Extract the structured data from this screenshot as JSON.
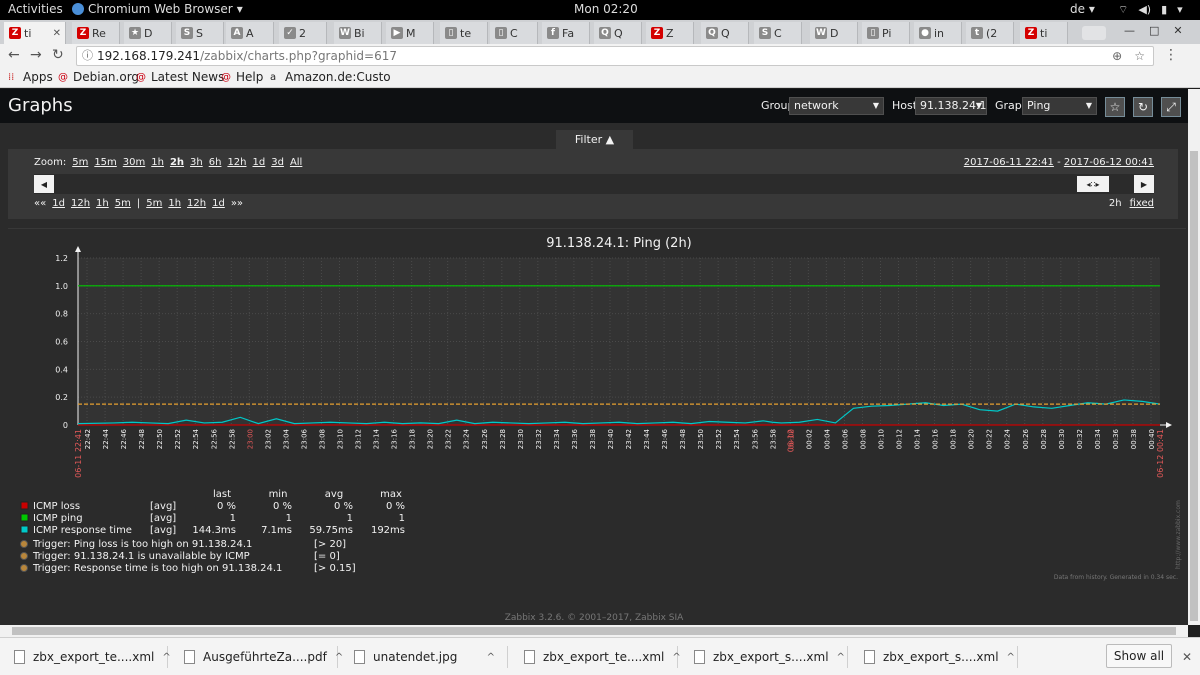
{
  "topbar": {
    "activities": "Activities",
    "app": "Chromium Web Browser",
    "clock": "Mon 02:20",
    "lang": "de"
  },
  "tabs": [
    {
      "label": "ti",
      "fav": "Z"
    },
    {
      "label": "Re",
      "fav": "Z"
    },
    {
      "label": "D",
      "fav": "★"
    },
    {
      "label": "S",
      "fav": "S"
    },
    {
      "label": "A",
      "fav": "A"
    },
    {
      "label": "2",
      "fav": "✓"
    },
    {
      "label": "Bi",
      "fav": "W"
    },
    {
      "label": "M",
      "fav": "▶"
    },
    {
      "label": "te",
      "fav": "▯"
    },
    {
      "label": "C",
      "fav": "▯"
    },
    {
      "label": "Fa",
      "fav": "f"
    },
    {
      "label": "Q",
      "fav": "Q"
    },
    {
      "label": "Z",
      "fav": "Z"
    },
    {
      "label": "Q",
      "fav": "Q"
    },
    {
      "label": "C",
      "fav": "S"
    },
    {
      "label": "D",
      "fav": "W"
    },
    {
      "label": "Pi",
      "fav": "▯"
    },
    {
      "label": "in",
      "fav": "●"
    },
    {
      "label": "(2",
      "fav": "t"
    },
    {
      "label": "ti",
      "fav": "Z"
    }
  ],
  "toolbar": {
    "url_host": "192.168.179.241",
    "url_path": "/zabbix/charts.php?graphid=617"
  },
  "bookmarks": [
    {
      "label": "Apps"
    },
    {
      "label": "Debian.org"
    },
    {
      "label": "Latest News"
    },
    {
      "label": "Help"
    },
    {
      "label": "Amazon.de:Custo"
    }
  ],
  "page": {
    "title": "Graphs",
    "group_label": "Group",
    "group_value": "network",
    "host_label": "Host",
    "host_value": "91.138.24.1",
    "graph_label": "Graph",
    "graph_value": "Ping",
    "filter_label": "Filter ▲"
  },
  "filter": {
    "zoom_label": "Zoom:",
    "zoom_options": [
      "5m",
      "15m",
      "30m",
      "1h",
      "2h",
      "3h",
      "6h",
      "12h",
      "1d",
      "3d",
      "All"
    ],
    "zoom_selected": "2h",
    "period_from": "2017-06-11 22:41",
    "period_sep": " - ",
    "period_to": "2017-06-12 00:41",
    "nav_back": [
      "««",
      "1d",
      "12h",
      "1h",
      "5m"
    ],
    "nav_sep": "|",
    "nav_fwd": [
      "5m",
      "1h",
      "12h",
      "1d",
      "»»"
    ],
    "duration": "2h",
    "fixed": "fixed"
  },
  "chart_data": {
    "type": "line",
    "title": "91.138.24.1: Ping (2h)",
    "ylim": [
      0,
      1.2
    ],
    "y_ticks": [
      "1.2",
      "1.0",
      "0.8",
      "0.6",
      "0.4",
      "0.2",
      "0"
    ],
    "x_ticks": [
      "22:42",
      "22:44",
      "22:46",
      "22:48",
      "22:50",
      "22:52",
      "22:54",
      "22:56",
      "22:58",
      "23:00",
      "23:02",
      "23:04",
      "23:06",
      "23:08",
      "23:10",
      "23:12",
      "23:14",
      "23:16",
      "23:18",
      "23:20",
      "23:22",
      "23:24",
      "23:26",
      "23:28",
      "23:30",
      "23:32",
      "23:34",
      "23:36",
      "23:38",
      "23:40",
      "23:42",
      "23:44",
      "23:46",
      "23:48",
      "23:50",
      "23:52",
      "23:54",
      "23:56",
      "23:58",
      "00:00",
      "00:02",
      "00:04",
      "00:06",
      "00:08",
      "00:10",
      "00:12",
      "00:14",
      "00:16",
      "00:18",
      "00:20",
      "00:22",
      "00:24",
      "00:26",
      "00:28",
      "00:30",
      "00:32",
      "00:34",
      "00:36",
      "00:38",
      "00:40"
    ],
    "x_red_ticks": [
      "23:00",
      "00:00"
    ],
    "x_start_label": "06-11 22:41",
    "x_end_label": "06-12 00:41",
    "x_mid_label": "06-12",
    "x_range_min": [
      0,
      120
    ],
    "series": [
      {
        "name": "ICMP loss",
        "color": "#c80000",
        "x": [
          0,
          120
        ],
        "y": [
          0,
          0
        ]
      },
      {
        "name": "ICMP ping",
        "color": "#00c800",
        "x": [
          0,
          120
        ],
        "y": [
          1,
          1
        ]
      },
      {
        "name": "ICMP response time",
        "color": "#00c8c8",
        "x": [
          0,
          4,
          6,
          8,
          10,
          12,
          14,
          16,
          18,
          20,
          22,
          24,
          26,
          28,
          30,
          32,
          34,
          36,
          38,
          40,
          42,
          44,
          46,
          48,
          50,
          52,
          54,
          56,
          58,
          60,
          62,
          64,
          66,
          68,
          70,
          72,
          74,
          76,
          77,
          78,
          80,
          82,
          84,
          86,
          88,
          90,
          92,
          94,
          96,
          98,
          100,
          102,
          104,
          106,
          108,
          110,
          112,
          114,
          116,
          118,
          120
        ],
        "y": [
          0.01,
          0.015,
          0.02,
          0.015,
          0.01,
          0.035,
          0.015,
          0.02,
          0.055,
          0.01,
          0.045,
          0.01,
          0.015,
          0.02,
          0.015,
          0.01,
          0.02,
          0.01,
          0.015,
          0.01,
          0.035,
          0.01,
          0.02,
          0.015,
          0.01,
          0.015,
          0.02,
          0.01,
          0.015,
          0.02,
          0.01,
          0.015,
          0.02,
          0.01,
          0.025,
          0.02,
          0.015,
          0.03,
          0.02,
          0.015,
          0.02,
          0.04,
          0.015,
          0.12,
          0.135,
          0.14,
          0.15,
          0.16,
          0.14,
          0.15,
          0.11,
          0.1,
          0.15,
          0.13,
          0.12,
          0.14,
          0.16,
          0.15,
          0.18,
          0.17,
          0.15
        ]
      },
      {
        "name": "Trigger: Response time is too high on 91.138.24.1",
        "color": "#e6a030",
        "x": [
          0,
          120
        ],
        "y": [
          0.15,
          0.15
        ]
      }
    ]
  },
  "legend": {
    "headers": [
      "last",
      "min",
      "avg",
      "max"
    ],
    "items": [
      {
        "name": "ICMP loss",
        "func": "[avg]",
        "last": "0 %",
        "min": "0 %",
        "avg": "0 %",
        "max": "0 %",
        "color": "#c80000"
      },
      {
        "name": "ICMP ping",
        "func": "[avg]",
        "last": "1",
        "min": "1",
        "avg": "1",
        "max": "1",
        "color": "#00c800"
      },
      {
        "name": "ICMP response time",
        "func": "[avg]",
        "last": "144.3ms",
        "min": "7.1ms",
        "avg": "59.75ms",
        "max": "192ms",
        "color": "#00c8c8"
      }
    ],
    "triggers": [
      {
        "name": "Trigger: Ping loss is too high on 91.138.24.1",
        "cond": "[> 20]"
      },
      {
        "name": "Trigger: 91.138.24.1 is unavailable by ICMP",
        "cond": "[= 0]"
      },
      {
        "name": "Trigger: Response time is too high on 91.138.24.1",
        "cond": "[> 0.15]"
      }
    ],
    "data_note": "Data from history. Generated in 0.34 sec.",
    "side_note": "http://www.zabbix.com"
  },
  "footer": "Zabbix 3.2.6. © 2001–2017, Zabbix SIA",
  "downloads": [
    {
      "name": "zbx_export_te....xml"
    },
    {
      "name": "AusgeführteZa....pdf"
    },
    {
      "name": "unatendet.jpg"
    },
    {
      "name": "zbx_export_te....xml"
    },
    {
      "name": "zbx_export_s....xml"
    },
    {
      "name": "zbx_export_s....xml"
    }
  ],
  "show_all": "Show all"
}
